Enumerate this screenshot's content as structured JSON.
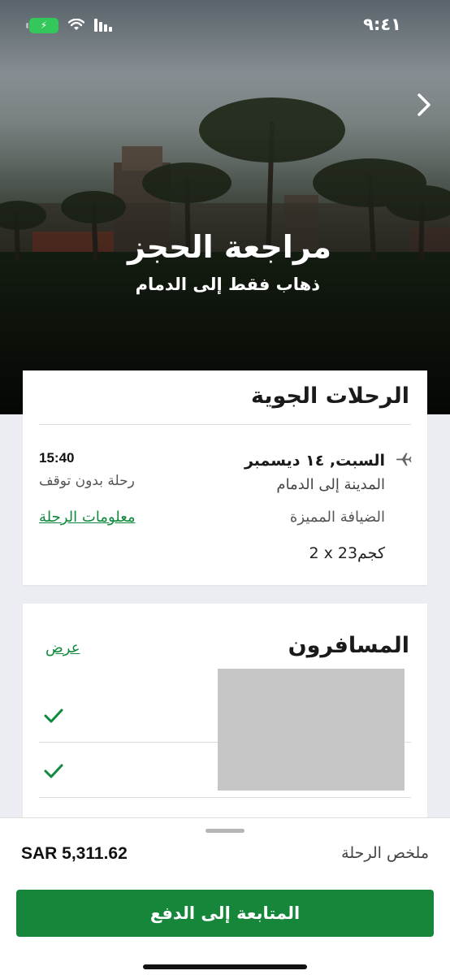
{
  "status_bar": {
    "time": "٩:٤١",
    "battery_icon": "battery-charging-icon",
    "wifi_icon": "wifi-icon",
    "signal_icon": "signal-icon"
  },
  "hero": {
    "title": "مراجعة الحجز",
    "subtitle": "ذهاب فقط إلى الدمام",
    "nav_icon": "chevron-right-icon"
  },
  "flights": {
    "heading": "الرحلات الجوية",
    "date": "السبت, ١٤ ديسمبر",
    "route": "المدينة إلى الدمام",
    "cabin_class": "الضيافة المميزة",
    "baggage": "2 x 23كجم",
    "time": "15:40",
    "stops": "رحلة بدون توقف",
    "details_link": "معلومات الرحلة",
    "icon": "airplane-icon"
  },
  "passengers": {
    "heading": "المسافرون",
    "view_link": "عرض",
    "rows": [
      {
        "status_icon": "checkmark-icon"
      },
      {
        "status_icon": "checkmark-icon"
      }
    ]
  },
  "summary": {
    "label": "ملخص الرحلة",
    "total": "SAR 5,311.62",
    "pay_button": "المتابعة إلى الدفع"
  },
  "colors": {
    "accent_green": "#16863b",
    "link_green": "#0f8a3c",
    "background": "#ecedf2"
  }
}
